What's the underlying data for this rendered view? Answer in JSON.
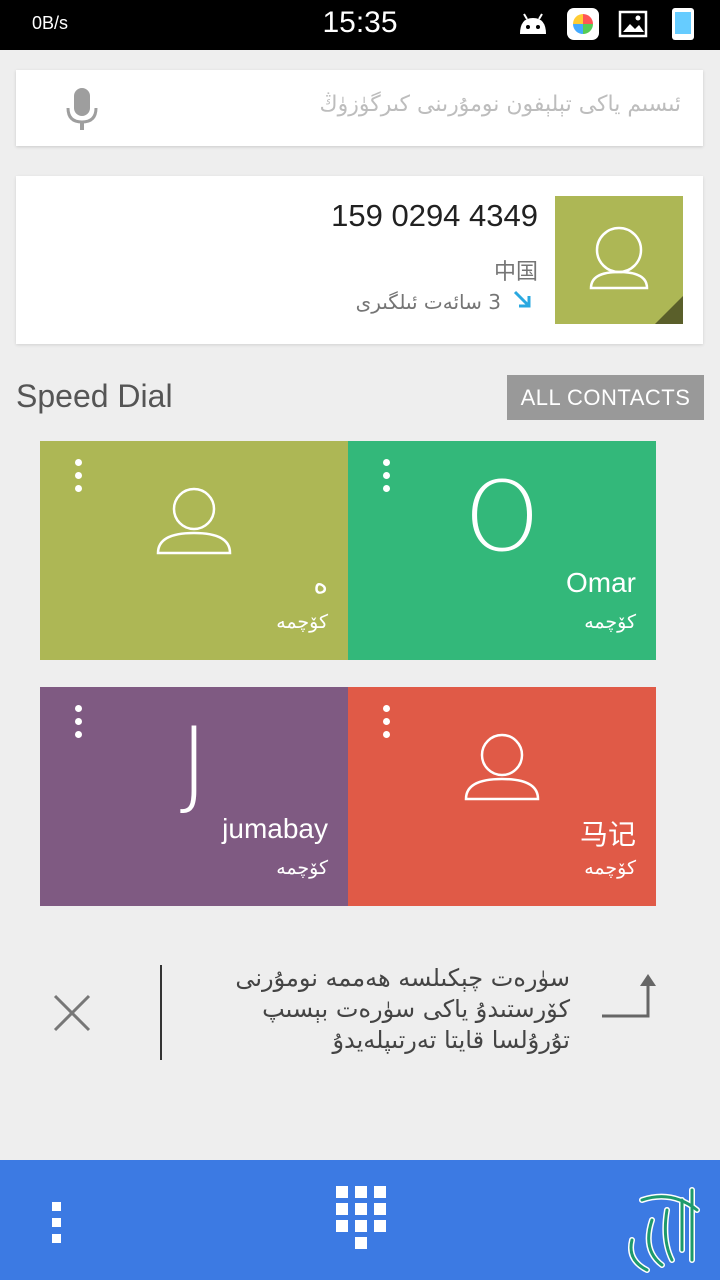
{
  "status_bar": {
    "net_speed": "0B/s",
    "time": "15:35",
    "icons": [
      "android-icon",
      "app-store-icon",
      "gallery-icon",
      "phone-signal-icon"
    ]
  },
  "search": {
    "placeholder": "ئىسىم ياكى تېلېفون نومۇرىنى كىرگۈزۈڭ",
    "mic_icon": "mic-icon"
  },
  "recent_call": {
    "number": "159 0294 4349",
    "location": "中国",
    "time_ago": "3 سائەت ئىلگىرى",
    "call_type_icon": "incoming-call-arrow-icon",
    "avatar_color": "#adb755"
  },
  "speed_dial": {
    "title": "Speed Dial",
    "all_contacts_label": "ALL CONTACTS",
    "tiles": [
      {
        "name": "ە",
        "type": "كۆچمە",
        "color": "#adb755",
        "avatar": "person-icon"
      },
      {
        "name": "Omar",
        "type": "كۆچمە",
        "color": "#33b87a",
        "letter": "O"
      },
      {
        "name": "jumabay",
        "type": "كۆچمە",
        "color": "#7f5a82",
        "letter": "J"
      },
      {
        "name": "马记",
        "type": "كۆچمە",
        "color": "#e05a47",
        "avatar": "person-icon"
      }
    ]
  },
  "hint": {
    "text": "سۈرەت چېكىلسە ھەممە نومۇرنى كۆرستىدۇ ياكى سۈرەت بېسىپ تۇرۇلسا قايتا تەرتىپلەيدۇ"
  },
  "bottom_bar": {
    "color": "#3c7ae3",
    "icons": [
      "overflow-menu-icon",
      "dialpad-icon",
      "logo-calligraphy"
    ]
  }
}
